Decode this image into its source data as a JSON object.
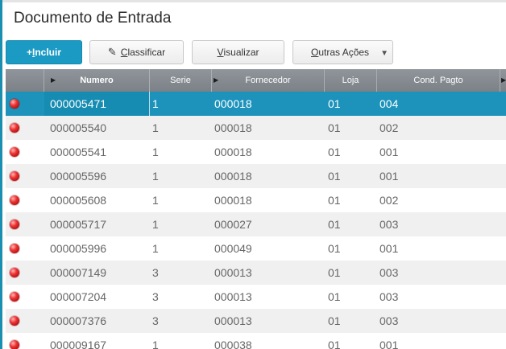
{
  "window": {
    "title": "Documento de Entrada"
  },
  "toolbar": {
    "incluir": {
      "prefix": "+ ",
      "u": "I",
      "rest": "ncluir"
    },
    "classificar": {
      "u": "C",
      "rest": "lassificar"
    },
    "visualizar": {
      "u": "V",
      "rest": "isualizar"
    },
    "outras": {
      "u": "O",
      "rest": "utras Ações"
    }
  },
  "grid": {
    "columns": [
      "Numero",
      "Serie",
      "Fornecedor",
      "Loja",
      "Cond. Pagto"
    ],
    "status_color": "#e02a2a",
    "selected_row_color": "#1d93bb",
    "rows": [
      {
        "numero": "000005471",
        "serie": "1",
        "fornecedor": "000018",
        "loja": "01",
        "cond": "004"
      },
      {
        "numero": "000005540",
        "serie": "1",
        "fornecedor": "000018",
        "loja": "01",
        "cond": "002"
      },
      {
        "numero": "000005541",
        "serie": "1",
        "fornecedor": "000018",
        "loja": "01",
        "cond": "001"
      },
      {
        "numero": "000005596",
        "serie": "1",
        "fornecedor": "000018",
        "loja": "01",
        "cond": "001"
      },
      {
        "numero": "000005608",
        "serie": "1",
        "fornecedor": "000018",
        "loja": "01",
        "cond": "002"
      },
      {
        "numero": "000005717",
        "serie": "1",
        "fornecedor": "000027",
        "loja": "01",
        "cond": "003"
      },
      {
        "numero": "000005996",
        "serie": "1",
        "fornecedor": "000049",
        "loja": "01",
        "cond": "001"
      },
      {
        "numero": "000007149",
        "serie": "3",
        "fornecedor": "000013",
        "loja": "01",
        "cond": "003"
      },
      {
        "numero": "000007204",
        "serie": "3",
        "fornecedor": "000013",
        "loja": "01",
        "cond": "003"
      },
      {
        "numero": "000007376",
        "serie": "3",
        "fornecedor": "000013",
        "loja": "01",
        "cond": "003"
      },
      {
        "numero": "000009167",
        "serie": "1",
        "fornecedor": "000038",
        "loja": "01",
        "cond": "001"
      }
    ]
  }
}
